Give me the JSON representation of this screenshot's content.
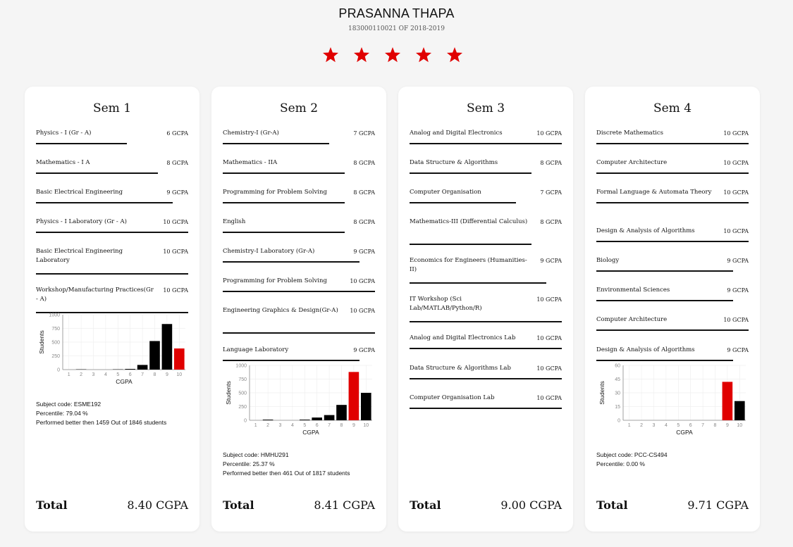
{
  "student": {
    "name": "PRASANNA THAPA",
    "subtitle": "183000110021 OF 2018-2019",
    "stars": 5,
    "star_color": "#e00000"
  },
  "colors": {
    "highlight": "#e00000",
    "bar": "#000000"
  },
  "semesters": [
    {
      "title": "Sem 1",
      "subjects": [
        {
          "name": "Physics - I (Gr - A)",
          "grade": "6 GCPA"
        },
        {
          "name": "Mathematics - I A",
          "grade": "8 GCPA"
        },
        {
          "name": "Basic Electrical Engineering",
          "grade": "9 GCPA"
        },
        {
          "name": "Physics - I Laboratory (Gr - A)",
          "grade": "10 GCPA"
        },
        {
          "name": "Basic Electrical Engineering Laboratory",
          "grade": "10 GCPA"
        },
        {
          "name": "Workshop/Manufacturing Practices(Gr - A)",
          "grade": "10 GCPA"
        }
      ],
      "info": {
        "subject_code": "Subject code: ESME192",
        "percentile": "Percentile: 79.04 %",
        "performed": "Performed better then 1459 Out of 1846 students"
      },
      "total_label": "Total",
      "total_value": "8.40 CGPA"
    },
    {
      "title": "Sem 2",
      "subjects": [
        {
          "name": "Chemistry-I (Gr-A)",
          "grade": "7 GCPA"
        },
        {
          "name": "Mathematics - IIA",
          "grade": "8 GCPA"
        },
        {
          "name": "Programming for Problem Solving",
          "grade": "8 GCPA"
        },
        {
          "name": "English",
          "grade": "8 GCPA"
        },
        {
          "name": "Chemistry-I Laboratory (Gr-A)",
          "grade": "9 GCPA"
        },
        {
          "name": "Programming for Problem Solving",
          "grade": "10 GCPA"
        },
        {
          "name": "Engineering Graphics & Design(Gr-A)",
          "grade": "10 GCPA"
        },
        {
          "name": "Language Laboratory",
          "grade": "9 GCPA"
        }
      ],
      "info": {
        "subject_code": "Subject code: HMHU291",
        "percentile": "Percentile: 25.37 %",
        "performed": "Performed better then 461 Out of 1817 students"
      },
      "total_label": "Total",
      "total_value": "8.41 CGPA"
    },
    {
      "title": "Sem 3",
      "subjects": [
        {
          "name": "Analog and Digital Electronics",
          "grade": "10 GCPA"
        },
        {
          "name": "Data Structure & Algorithms",
          "grade": "8 GCPA"
        },
        {
          "name": "Computer Organisation",
          "grade": "7 GCPA"
        },
        {
          "name": "Mathematics-III (Differential Calculus)",
          "grade": "8 GCPA"
        },
        {
          "name": "Economics for Engineers (Humanities-II)",
          "grade": "9 GCPA"
        },
        {
          "name": "IT Workshop (Sci Lab/MATLAB/Python/R)",
          "grade": "10 GCPA"
        },
        {
          "name": "Analog and Digital Electronics Lab",
          "grade": "10 GCPA"
        },
        {
          "name": "Data Structure & Algorithms Lab",
          "grade": "10 GCPA"
        },
        {
          "name": "Computer Organisation Lab",
          "grade": "10 GCPA"
        }
      ],
      "total_label": "Total",
      "total_value": "9.00 CGPA"
    },
    {
      "title": "Sem 4",
      "subjects": [
        {
          "name": "Discrete Mathematics",
          "grade": "10 GCPA"
        },
        {
          "name": "Computer Architecture",
          "grade": "10 GCPA"
        },
        {
          "name": "Formal Language & Automata Theory",
          "grade": "10 GCPA"
        },
        {
          "name": "Design & Analysis of Algorithms",
          "grade": "10 GCPA"
        },
        {
          "name": "Biology",
          "grade": "9 GCPA"
        },
        {
          "name": "Environmental Sciences",
          "grade": "9 GCPA"
        },
        {
          "name": "Computer Architecture",
          "grade": "10 GCPA"
        },
        {
          "name": "Design & Analysis of Algorithms",
          "grade": "9 GCPA"
        }
      ],
      "info": {
        "subject_code": "Subject code: PCC-CS494",
        "percentile": "Percentile: 0.00 %"
      },
      "total_label": "Total",
      "total_value": "9.71 CGPA"
    }
  ],
  "chart_data": [
    {
      "type": "bar",
      "semester": "Sem 1",
      "xlabel": "CGPA",
      "ylabel": "Students",
      "categories": [
        "1",
        "2",
        "3",
        "4",
        "5",
        "6",
        "7",
        "8",
        "9",
        "10"
      ],
      "values": [
        0,
        5,
        0,
        0,
        5,
        12,
        85,
        520,
        830,
        385
      ],
      "highlight_category": "10",
      "ylim": [
        0,
        1000
      ],
      "yticks": [
        "0",
        "250",
        "500",
        "750",
        "1000"
      ],
      "grid": true
    },
    {
      "type": "bar",
      "semester": "Sem 2",
      "xlabel": "CGPA",
      "ylabel": "Students",
      "categories": [
        "1",
        "2",
        "3",
        "4",
        "5",
        "6",
        "7",
        "8",
        "9",
        "10"
      ],
      "values": [
        0,
        12,
        0,
        0,
        12,
        50,
        95,
        280,
        880,
        500
      ],
      "highlight_category": "9",
      "ylim": [
        0,
        1000
      ],
      "yticks": [
        "0",
        "250",
        "500",
        "750",
        "1000"
      ],
      "grid": true
    },
    {
      "type": "bar",
      "semester": "Sem 4",
      "xlabel": "CGPA",
      "ylabel": "Students",
      "categories": [
        "1",
        "2",
        "3",
        "4",
        "5",
        "6",
        "7",
        "8",
        "9",
        "10"
      ],
      "values": [
        0,
        0,
        0,
        0,
        0,
        0,
        0,
        0,
        42,
        21
      ],
      "highlight_category": "9",
      "ylim": [
        0,
        60
      ],
      "yticks": [
        "0",
        "15",
        "30",
        "45",
        "60"
      ],
      "grid": true
    }
  ]
}
